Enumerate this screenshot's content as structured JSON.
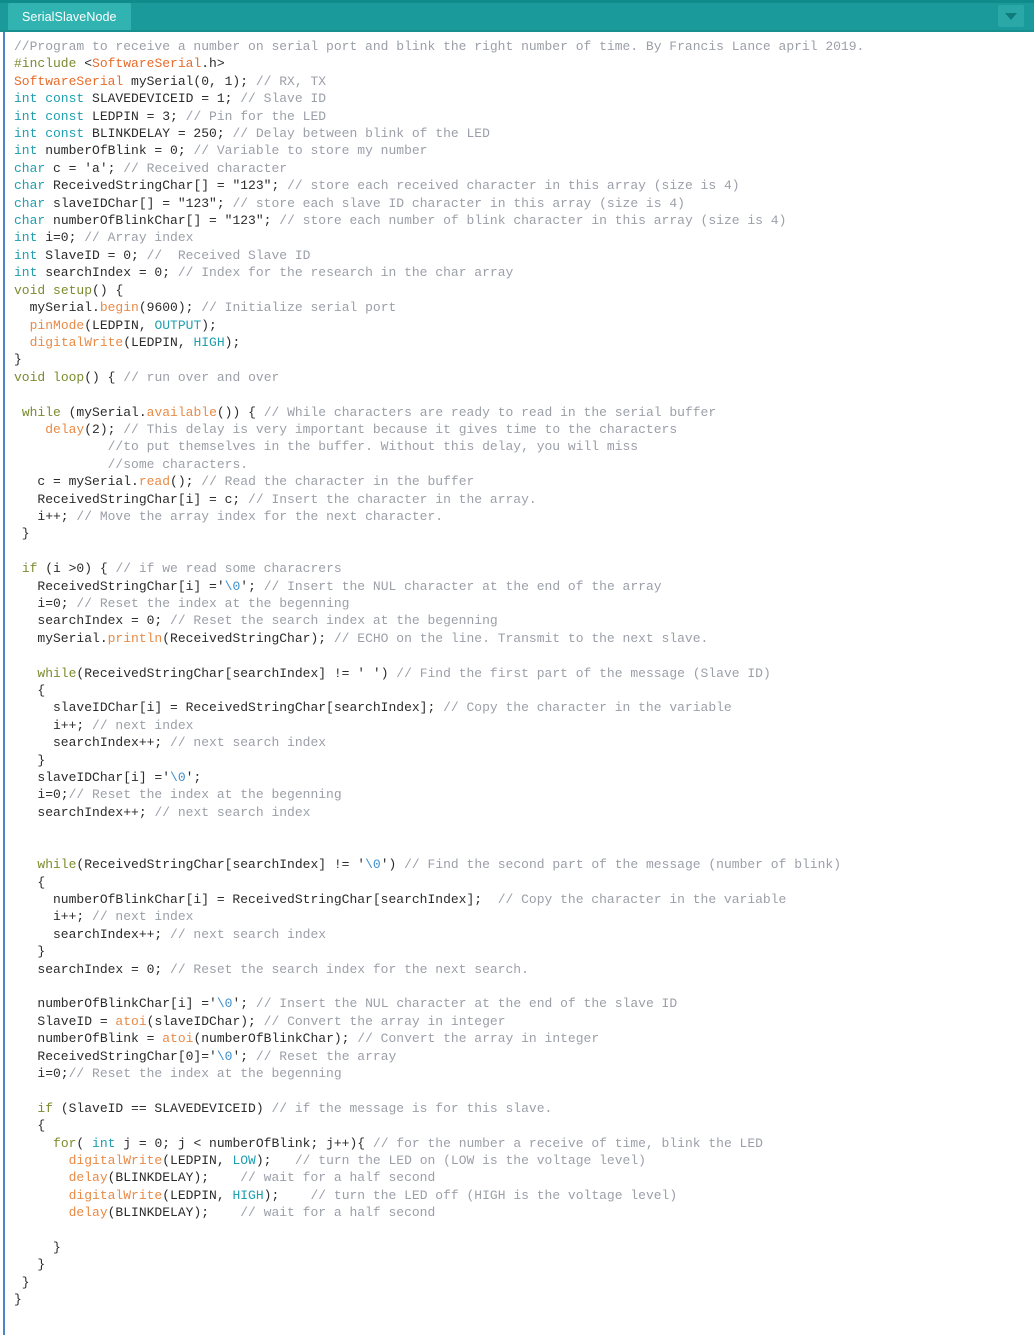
{
  "window": {
    "accent_color": "#1a9a9a",
    "tab_active_color": "#31b3b2",
    "editor_background": "#ffffff"
  },
  "tabbar": {
    "tabs": [
      {
        "label": "SerialSlaveNode",
        "active": true
      }
    ],
    "menu_button_icon": "chevron-down-icon"
  },
  "syntax_colors": {
    "comment": "#9b9fa8",
    "keyword": "#7a8c2e",
    "datatype": "#1f9fb0",
    "function": "#e98a46",
    "class": "#e86b2a",
    "literal": "#1f9fb0",
    "escape": "#3f8ecb",
    "plain": "#2b2b2b"
  },
  "editor": {
    "language": "arduino-cpp",
    "file_name": "SerialSlaveNode",
    "lines": [
      [
        [
          "cm",
          "//Program to receive a number on serial port and blink the right number of time. By Francis Lance april 2019."
        ]
      ],
      [
        [
          "kw",
          "#include"
        ],
        [
          "pl",
          " <"
        ],
        [
          "cls",
          "SoftwareSerial"
        ],
        [
          "pl",
          ".h>"
        ]
      ],
      [
        [
          "cls",
          "SoftwareSerial"
        ],
        [
          "pl",
          " mySerial(0, 1); "
        ],
        [
          "cm",
          "// RX, TX"
        ]
      ],
      [
        [
          "ty",
          "int const"
        ],
        [
          "pl",
          " SLAVEDEVICEID = 1; "
        ],
        [
          "cm",
          "// Slave ID"
        ]
      ],
      [
        [
          "ty",
          "int const"
        ],
        [
          "pl",
          " LEDPIN = 3; "
        ],
        [
          "cm",
          "// Pin for the LED"
        ]
      ],
      [
        [
          "ty",
          "int const"
        ],
        [
          "pl",
          " BLINKDELAY = 250; "
        ],
        [
          "cm",
          "// Delay between blink of the LED"
        ]
      ],
      [
        [
          "ty",
          "int"
        ],
        [
          "pl",
          " numberOfBlink = 0; "
        ],
        [
          "cm",
          "// Variable to store my number"
        ]
      ],
      [
        [
          "ty",
          "char"
        ],
        [
          "pl",
          " c = "
        ],
        [
          "str",
          "'a'"
        ],
        [
          "pl",
          "; "
        ],
        [
          "cm",
          "// Received character"
        ]
      ],
      [
        [
          "ty",
          "char"
        ],
        [
          "pl",
          " ReceivedStringChar[] = "
        ],
        [
          "str",
          "\"123\""
        ],
        [
          "pl",
          "; "
        ],
        [
          "cm",
          "// store each received character in this array (size is 4)"
        ]
      ],
      [
        [
          "ty",
          "char"
        ],
        [
          "pl",
          " slaveIDChar[] = "
        ],
        [
          "str",
          "\"123\""
        ],
        [
          "pl",
          "; "
        ],
        [
          "cm",
          "// store each slave ID character in this array (size is 4)"
        ]
      ],
      [
        [
          "ty",
          "char"
        ],
        [
          "pl",
          " numberOfBlinkChar[] = "
        ],
        [
          "str",
          "\"123\""
        ],
        [
          "pl",
          "; "
        ],
        [
          "cm",
          "// store each number of blink character in this array (size is 4)"
        ]
      ],
      [
        [
          "ty",
          "int"
        ],
        [
          "pl",
          " i=0; "
        ],
        [
          "cm",
          "// Array index"
        ]
      ],
      [
        [
          "ty",
          "int"
        ],
        [
          "pl",
          " SlaveID = 0; "
        ],
        [
          "cm",
          "//  Received Slave ID"
        ]
      ],
      [
        [
          "ty",
          "int"
        ],
        [
          "pl",
          " searchIndex = 0; "
        ],
        [
          "cm",
          "// Index for the research in the char array"
        ]
      ],
      [
        [
          "kw",
          "void"
        ],
        [
          "pl",
          " "
        ],
        [
          "kw",
          "setup"
        ],
        [
          "pl",
          "() {"
        ]
      ],
      [
        [
          "pl",
          "  mySerial."
        ],
        [
          "fn",
          "begin"
        ],
        [
          "pl",
          "(9600); "
        ],
        [
          "cm",
          "// Initialize serial port"
        ]
      ],
      [
        [
          "pl",
          "  "
        ],
        [
          "fn",
          "pinMode"
        ],
        [
          "pl",
          "(LEDPIN, "
        ],
        [
          "lit",
          "OUTPUT"
        ],
        [
          "pl",
          ");"
        ]
      ],
      [
        [
          "pl",
          "  "
        ],
        [
          "fn",
          "digitalWrite"
        ],
        [
          "pl",
          "(LEDPIN, "
        ],
        [
          "lit",
          "HIGH"
        ],
        [
          "pl",
          ");"
        ]
      ],
      [
        [
          "pl",
          "}"
        ]
      ],
      [
        [
          "kw",
          "void"
        ],
        [
          "pl",
          " "
        ],
        [
          "kw",
          "loop"
        ],
        [
          "pl",
          "() { "
        ],
        [
          "cm",
          "// run over and over"
        ]
      ],
      [],
      [
        [
          "pl",
          " "
        ],
        [
          "kw",
          "while"
        ],
        [
          "pl",
          " (mySerial."
        ],
        [
          "fn",
          "available"
        ],
        [
          "pl",
          "()) { "
        ],
        [
          "cm",
          "// While characters are ready to read in the serial buffer"
        ]
      ],
      [
        [
          "pl",
          "    "
        ],
        [
          "fn",
          "delay"
        ],
        [
          "pl",
          "(2); "
        ],
        [
          "cm",
          "// This delay is very important because it gives time to the characters"
        ]
      ],
      [
        [
          "pl",
          "            "
        ],
        [
          "cm",
          "//to put themselves in the buffer. Without this delay, you will miss"
        ]
      ],
      [
        [
          "pl",
          "            "
        ],
        [
          "cm",
          "//some characters."
        ]
      ],
      [
        [
          "pl",
          "   c = mySerial."
        ],
        [
          "fn",
          "read"
        ],
        [
          "pl",
          "(); "
        ],
        [
          "cm",
          "// Read the character in the buffer"
        ]
      ],
      [
        [
          "pl",
          "   ReceivedStringChar[i] = c; "
        ],
        [
          "cm",
          "// Insert the character in the array."
        ]
      ],
      [
        [
          "pl",
          "   i++; "
        ],
        [
          "cm",
          "// Move the array index for the next character."
        ]
      ],
      [
        [
          "pl",
          " }"
        ]
      ],
      [],
      [
        [
          "pl",
          " "
        ],
        [
          "kw",
          "if"
        ],
        [
          "pl",
          " (i >0) { "
        ],
        [
          "cm",
          "// if we read some characrers"
        ]
      ],
      [
        [
          "pl",
          "   ReceivedStringChar[i] ="
        ],
        [
          "str",
          "'"
        ],
        [
          "esc",
          "\\0"
        ],
        [
          "str",
          "'"
        ],
        [
          "pl",
          "; "
        ],
        [
          "cm",
          "// Insert the NUL character at the end of the array"
        ]
      ],
      [
        [
          "pl",
          "   i=0; "
        ],
        [
          "cm",
          "// Reset the index at the begenning"
        ]
      ],
      [
        [
          "pl",
          "   searchIndex = 0; "
        ],
        [
          "cm",
          "// Reset the search index at the begenning"
        ]
      ],
      [
        [
          "pl",
          "   mySerial."
        ],
        [
          "fn",
          "println"
        ],
        [
          "pl",
          "(ReceivedStringChar); "
        ],
        [
          "cm",
          "// ECHO on the line. Transmit to the next slave."
        ]
      ],
      [],
      [
        [
          "pl",
          "   "
        ],
        [
          "kw",
          "while"
        ],
        [
          "pl",
          "(ReceivedStringChar[searchIndex] != "
        ],
        [
          "str",
          "' '"
        ],
        [
          "pl",
          ") "
        ],
        [
          "cm",
          "// Find the first part of the message (Slave ID)"
        ]
      ],
      [
        [
          "pl",
          "   {"
        ]
      ],
      [
        [
          "pl",
          "     slaveIDChar[i] = ReceivedStringChar[searchIndex]; "
        ],
        [
          "cm",
          "// Copy the character in the variable"
        ]
      ],
      [
        [
          "pl",
          "     i++; "
        ],
        [
          "cm",
          "// next index"
        ]
      ],
      [
        [
          "pl",
          "     searchIndex++; "
        ],
        [
          "cm",
          "// next search index"
        ]
      ],
      [
        [
          "pl",
          "   }"
        ]
      ],
      [
        [
          "pl",
          "   slaveIDChar[i] ="
        ],
        [
          "str",
          "'"
        ],
        [
          "esc",
          "\\0"
        ],
        [
          "str",
          "'"
        ],
        [
          "pl",
          ";"
        ]
      ],
      [
        [
          "pl",
          "   i=0;"
        ],
        [
          "cm",
          "// Reset the index at the begenning"
        ]
      ],
      [
        [
          "pl",
          "   searchIndex++; "
        ],
        [
          "cm",
          "// next search index"
        ]
      ],
      [],
      [],
      [
        [
          "pl",
          "   "
        ],
        [
          "kw",
          "while"
        ],
        [
          "pl",
          "(ReceivedStringChar[searchIndex] != "
        ],
        [
          "str",
          "'"
        ],
        [
          "esc",
          "\\0"
        ],
        [
          "str",
          "'"
        ],
        [
          "pl",
          ") "
        ],
        [
          "cm",
          "// Find the second part of the message (number of blink)"
        ]
      ],
      [
        [
          "pl",
          "   {"
        ]
      ],
      [
        [
          "pl",
          "     numberOfBlinkChar[i] = ReceivedStringChar[searchIndex];  "
        ],
        [
          "cm",
          "// Copy the character in the variable"
        ]
      ],
      [
        [
          "pl",
          "     i++; "
        ],
        [
          "cm",
          "// next index"
        ]
      ],
      [
        [
          "pl",
          "     searchIndex++; "
        ],
        [
          "cm",
          "// next search index"
        ]
      ],
      [
        [
          "pl",
          "   }"
        ]
      ],
      [
        [
          "pl",
          "   searchIndex = 0; "
        ],
        [
          "cm",
          "// Reset the search index for the next search."
        ]
      ],
      [],
      [
        [
          "pl",
          "   numberOfBlinkChar[i] ="
        ],
        [
          "str",
          "'"
        ],
        [
          "esc",
          "\\0"
        ],
        [
          "str",
          "'"
        ],
        [
          "pl",
          "; "
        ],
        [
          "cm",
          "// Insert the NUL character at the end of the slave ID"
        ]
      ],
      [
        [
          "pl",
          "   SlaveID = "
        ],
        [
          "fn",
          "atoi"
        ],
        [
          "pl",
          "(slaveIDChar); "
        ],
        [
          "cm",
          "// Convert the array in integer"
        ]
      ],
      [
        [
          "pl",
          "   numberOfBlink = "
        ],
        [
          "fn",
          "atoi"
        ],
        [
          "pl",
          "(numberOfBlinkChar); "
        ],
        [
          "cm",
          "// Convert the array in integer"
        ]
      ],
      [
        [
          "pl",
          "   ReceivedStringChar[0]="
        ],
        [
          "str",
          "'"
        ],
        [
          "esc",
          "\\0"
        ],
        [
          "str",
          "'"
        ],
        [
          "pl",
          "; "
        ],
        [
          "cm",
          "// Reset the array"
        ]
      ],
      [
        [
          "pl",
          "   i=0;"
        ],
        [
          "cm",
          "// Reset the index at the begenning"
        ]
      ],
      [],
      [
        [
          "pl",
          "   "
        ],
        [
          "kw",
          "if"
        ],
        [
          "pl",
          " (SlaveID == SLAVEDEVICEID) "
        ],
        [
          "cm",
          "// if the message is for this slave."
        ]
      ],
      [
        [
          "pl",
          "   {"
        ]
      ],
      [
        [
          "pl",
          "     "
        ],
        [
          "kw",
          "for"
        ],
        [
          "pl",
          "( "
        ],
        [
          "ty",
          "int"
        ],
        [
          "pl",
          " j = 0; j < numberOfBlink; j++){ "
        ],
        [
          "cm",
          "// for the number a receive of time, blink the LED"
        ]
      ],
      [
        [
          "pl",
          "       "
        ],
        [
          "fn",
          "digitalWrite"
        ],
        [
          "pl",
          "(LEDPIN, "
        ],
        [
          "lit",
          "LOW"
        ],
        [
          "pl",
          ");   "
        ],
        [
          "cm",
          "// turn the LED on (LOW is the voltage level)"
        ]
      ],
      [
        [
          "pl",
          "       "
        ],
        [
          "fn",
          "delay"
        ],
        [
          "pl",
          "(BLINKDELAY);    "
        ],
        [
          "cm",
          "// wait for a half second"
        ]
      ],
      [
        [
          "pl",
          "       "
        ],
        [
          "fn",
          "digitalWrite"
        ],
        [
          "pl",
          "(LEDPIN, "
        ],
        [
          "lit",
          "HIGH"
        ],
        [
          "pl",
          ");    "
        ],
        [
          "cm",
          "// turn the LED off (HIGH is the voltage level)"
        ]
      ],
      [
        [
          "pl",
          "       "
        ],
        [
          "fn",
          "delay"
        ],
        [
          "pl",
          "(BLINKDELAY);    "
        ],
        [
          "cm",
          "// wait for a half second"
        ]
      ],
      [],
      [
        [
          "pl",
          "     }"
        ]
      ],
      [
        [
          "pl",
          "   }"
        ]
      ],
      [
        [
          "pl",
          " }"
        ]
      ],
      [
        [
          "pl",
          "}"
        ]
      ]
    ]
  }
}
